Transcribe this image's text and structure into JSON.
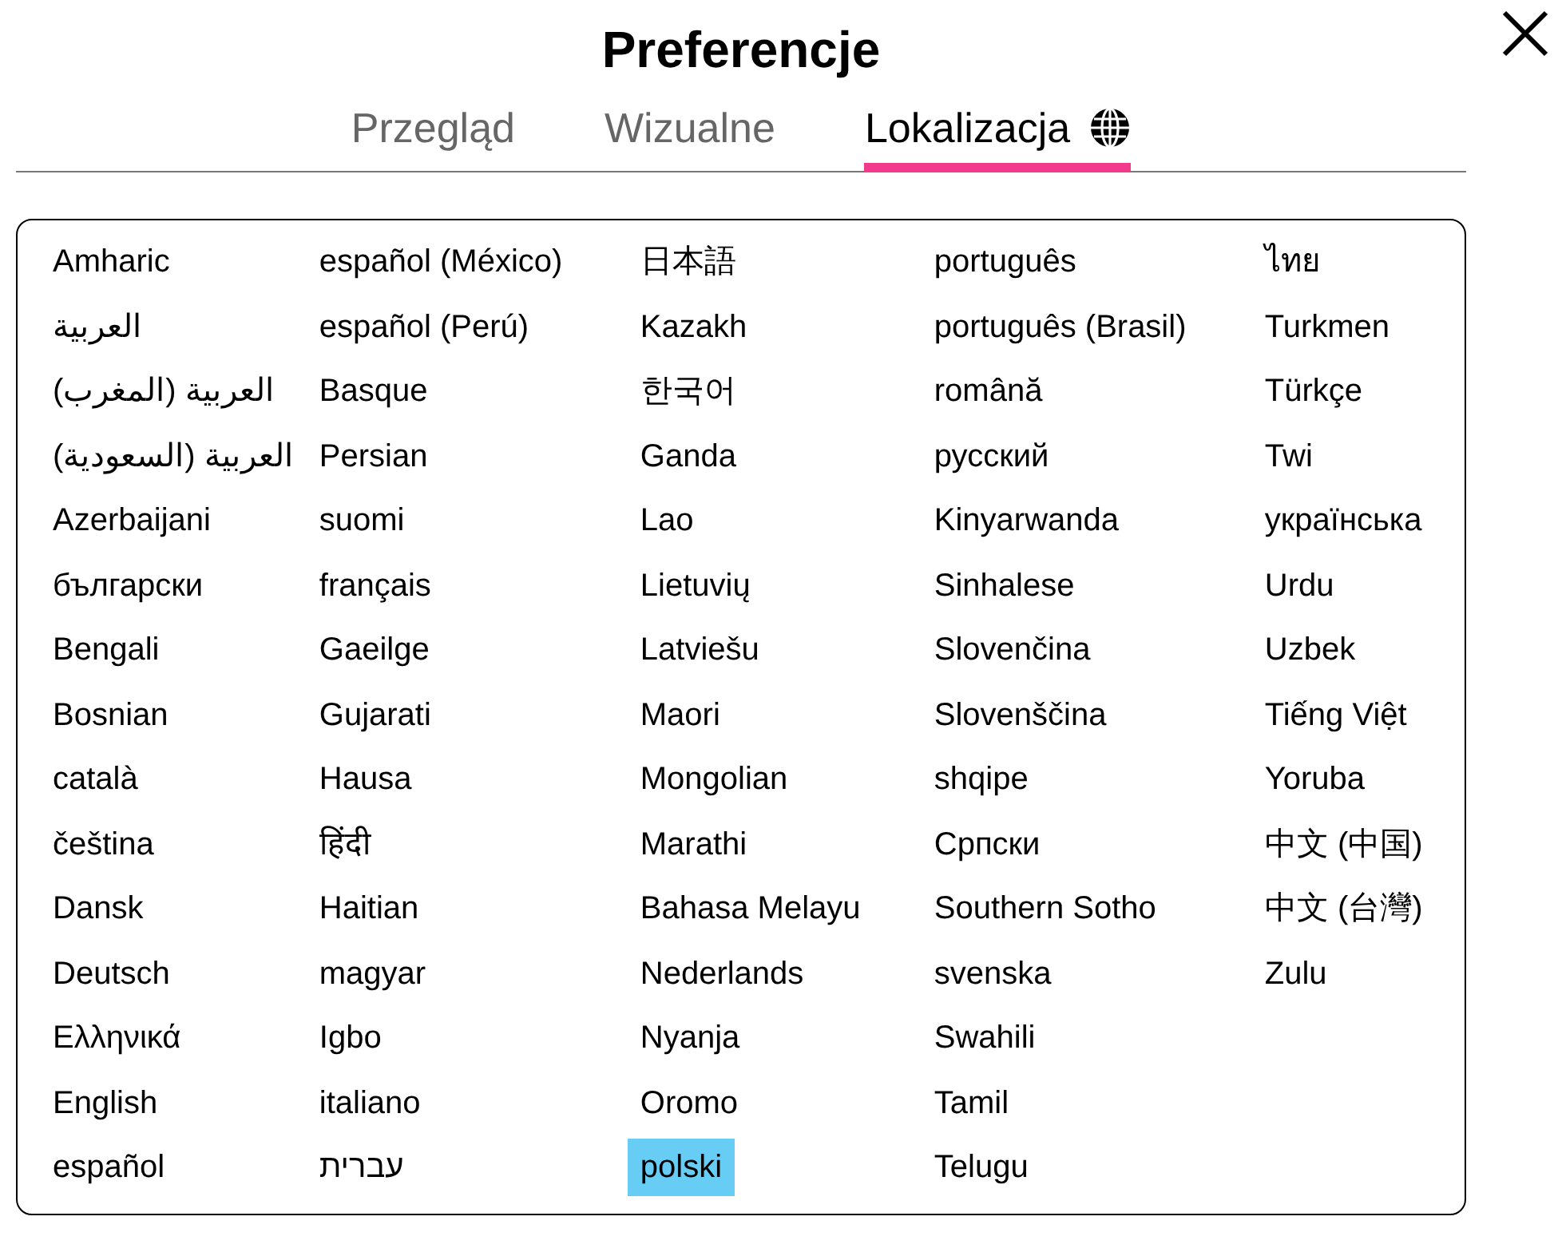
{
  "title": "Preferencje",
  "tabs": [
    {
      "label": "Przegląd",
      "selected": false,
      "icon": false
    },
    {
      "label": "Wizualne",
      "selected": false,
      "icon": false
    },
    {
      "label": "Lokalizacja",
      "selected": true,
      "icon": true
    }
  ],
  "languages": [
    {
      "label": "Amharic",
      "selected": false
    },
    {
      "label": "العربية",
      "selected": false
    },
    {
      "label": "العربية (المغرب)",
      "selected": false
    },
    {
      "label": "العربية (السعودية)",
      "selected": false
    },
    {
      "label": "Azerbaijani",
      "selected": false
    },
    {
      "label": "български",
      "selected": false
    },
    {
      "label": "Bengali",
      "selected": false
    },
    {
      "label": "Bosnian",
      "selected": false
    },
    {
      "label": "català",
      "selected": false
    },
    {
      "label": "čeština",
      "selected": false
    },
    {
      "label": "Dansk",
      "selected": false
    },
    {
      "label": "Deutsch",
      "selected": false
    },
    {
      "label": "Ελληνικά",
      "selected": false
    },
    {
      "label": "English",
      "selected": false
    },
    {
      "label": "español",
      "selected": false
    },
    {
      "label": "español (México)",
      "selected": false
    },
    {
      "label": "español (Perú)",
      "selected": false
    },
    {
      "label": "Basque",
      "selected": false
    },
    {
      "label": "Persian",
      "selected": false
    },
    {
      "label": "suomi",
      "selected": false
    },
    {
      "label": "français",
      "selected": false
    },
    {
      "label": "Gaeilge",
      "selected": false
    },
    {
      "label": "Gujarati",
      "selected": false
    },
    {
      "label": "Hausa",
      "selected": false
    },
    {
      "label": "हिंदी",
      "selected": false
    },
    {
      "label": "Haitian",
      "selected": false
    },
    {
      "label": "magyar",
      "selected": false
    },
    {
      "label": "Igbo",
      "selected": false
    },
    {
      "label": "italiano",
      "selected": false
    },
    {
      "label": "עברית",
      "selected": false
    },
    {
      "label": "日本語",
      "selected": false
    },
    {
      "label": "Kazakh",
      "selected": false
    },
    {
      "label": "한국어",
      "selected": false
    },
    {
      "label": "Ganda",
      "selected": false
    },
    {
      "label": "Lao",
      "selected": false
    },
    {
      "label": "Lietuvių",
      "selected": false
    },
    {
      "label": "Latviešu",
      "selected": false
    },
    {
      "label": "Maori",
      "selected": false
    },
    {
      "label": "Mongolian",
      "selected": false
    },
    {
      "label": "Marathi",
      "selected": false
    },
    {
      "label": "Bahasa Melayu",
      "selected": false
    },
    {
      "label": "Nederlands",
      "selected": false
    },
    {
      "label": "Nyanja",
      "selected": false
    },
    {
      "label": "Oromo",
      "selected": false
    },
    {
      "label": "polski",
      "selected": true
    },
    {
      "label": "português",
      "selected": false
    },
    {
      "label": "português (Brasil)",
      "selected": false
    },
    {
      "label": "română",
      "selected": false
    },
    {
      "label": "русский",
      "selected": false
    },
    {
      "label": "Kinyarwanda",
      "selected": false
    },
    {
      "label": "Sinhalese",
      "selected": false
    },
    {
      "label": "Slovenčina",
      "selected": false
    },
    {
      "label": "Slovenščina",
      "selected": false
    },
    {
      "label": "shqipe",
      "selected": false
    },
    {
      "label": "Српски",
      "selected": false
    },
    {
      "label": "Southern Sotho",
      "selected": false
    },
    {
      "label": "svenska",
      "selected": false
    },
    {
      "label": "Swahili",
      "selected": false
    },
    {
      "label": "Tamil",
      "selected": false
    },
    {
      "label": "Telugu",
      "selected": false
    },
    {
      "label": "ไทย",
      "selected": false
    },
    {
      "label": "Turkmen",
      "selected": false
    },
    {
      "label": "Türkçe",
      "selected": false
    },
    {
      "label": "Twi",
      "selected": false
    },
    {
      "label": "українська",
      "selected": false
    },
    {
      "label": "Urdu",
      "selected": false
    },
    {
      "label": "Uzbek",
      "selected": false
    },
    {
      "label": "Tiếng Việt",
      "selected": false
    },
    {
      "label": "Yoruba",
      "selected": false
    },
    {
      "label": "中文 (中国)",
      "selected": false
    },
    {
      "label": "中文 (台灣)",
      "selected": false
    },
    {
      "label": "Zulu",
      "selected": false
    }
  ]
}
